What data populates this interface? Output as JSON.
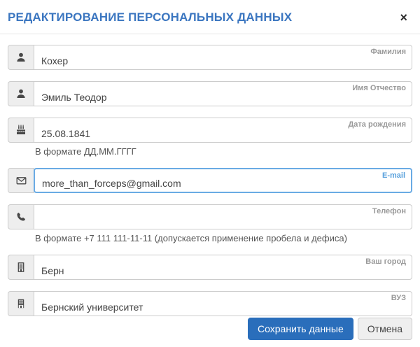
{
  "modal": {
    "title": "РЕДАКТИРОВАНИЕ ПЕРСОНАЛЬНЫХ ДАННЫХ",
    "close_glyph": "×"
  },
  "colors": {
    "title_blue": "#3b76c0",
    "accent_blue": "#2a6ebb",
    "focus_border": "#6aabe4",
    "email_label_blue": "#58a0dc",
    "field_border": "#cccccc",
    "icon_box_bg": "#eeeeee"
  },
  "fields": [
    {
      "label": "Фамилия",
      "value": "Кохер",
      "icon": "user-icon"
    },
    {
      "label": "Имя Отчество",
      "value": "Эмиль Теодор",
      "icon": "user-icon"
    },
    {
      "label": "Дата рождения",
      "value": "25.08.1841",
      "icon": "birthday-cake-icon",
      "hint": "В формате ДД.ММ.ГГГГ"
    },
    {
      "label": "E-mail",
      "value": "more_than_forceps@gmail.com",
      "icon": "envelope-icon",
      "focused": true
    },
    {
      "label": "Телефон",
      "value": "",
      "icon": "phone-icon",
      "hint": "В формате +7 111 111-11-11 (допускается применение пробела и дефиса)"
    },
    {
      "label": "Ваш город",
      "value": "Берн",
      "icon": "city-building-icon"
    },
    {
      "label": "ВУЗ",
      "value": "Бернский университет",
      "icon": "university-building-icon"
    }
  ],
  "footer": {
    "save_label": "Сохранить данные",
    "cancel_label": "Отмена"
  }
}
